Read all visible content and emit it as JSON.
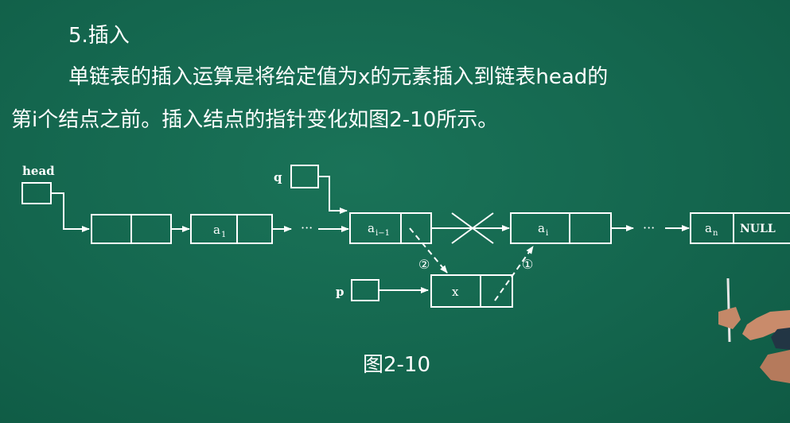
{
  "slide": {
    "heading": "5.插入",
    "paragraph_line1": "单链表的插入运算是将给定值为x的元素插入到链表head的",
    "paragraph_line2": "第i个结点之前。插入结点的指针变化如图2-10所示。",
    "caption": "图2-10"
  },
  "diagram": {
    "labels": {
      "head": "head",
      "q": "q",
      "p": "p",
      "ellipsis": "···",
      "node_a1": "a",
      "node_a1_sub": "1",
      "node_ai_minus1": "a",
      "node_ai_minus1_sub": "i−1",
      "node_ai": "a",
      "node_ai_sub": "i",
      "node_an": "a",
      "node_an_sub": "n",
      "null": "NULL",
      "new_node": "x",
      "step1": "①",
      "step2": "②"
    },
    "colors": {
      "board": "#14674f",
      "chalk": "#ffffff"
    }
  }
}
